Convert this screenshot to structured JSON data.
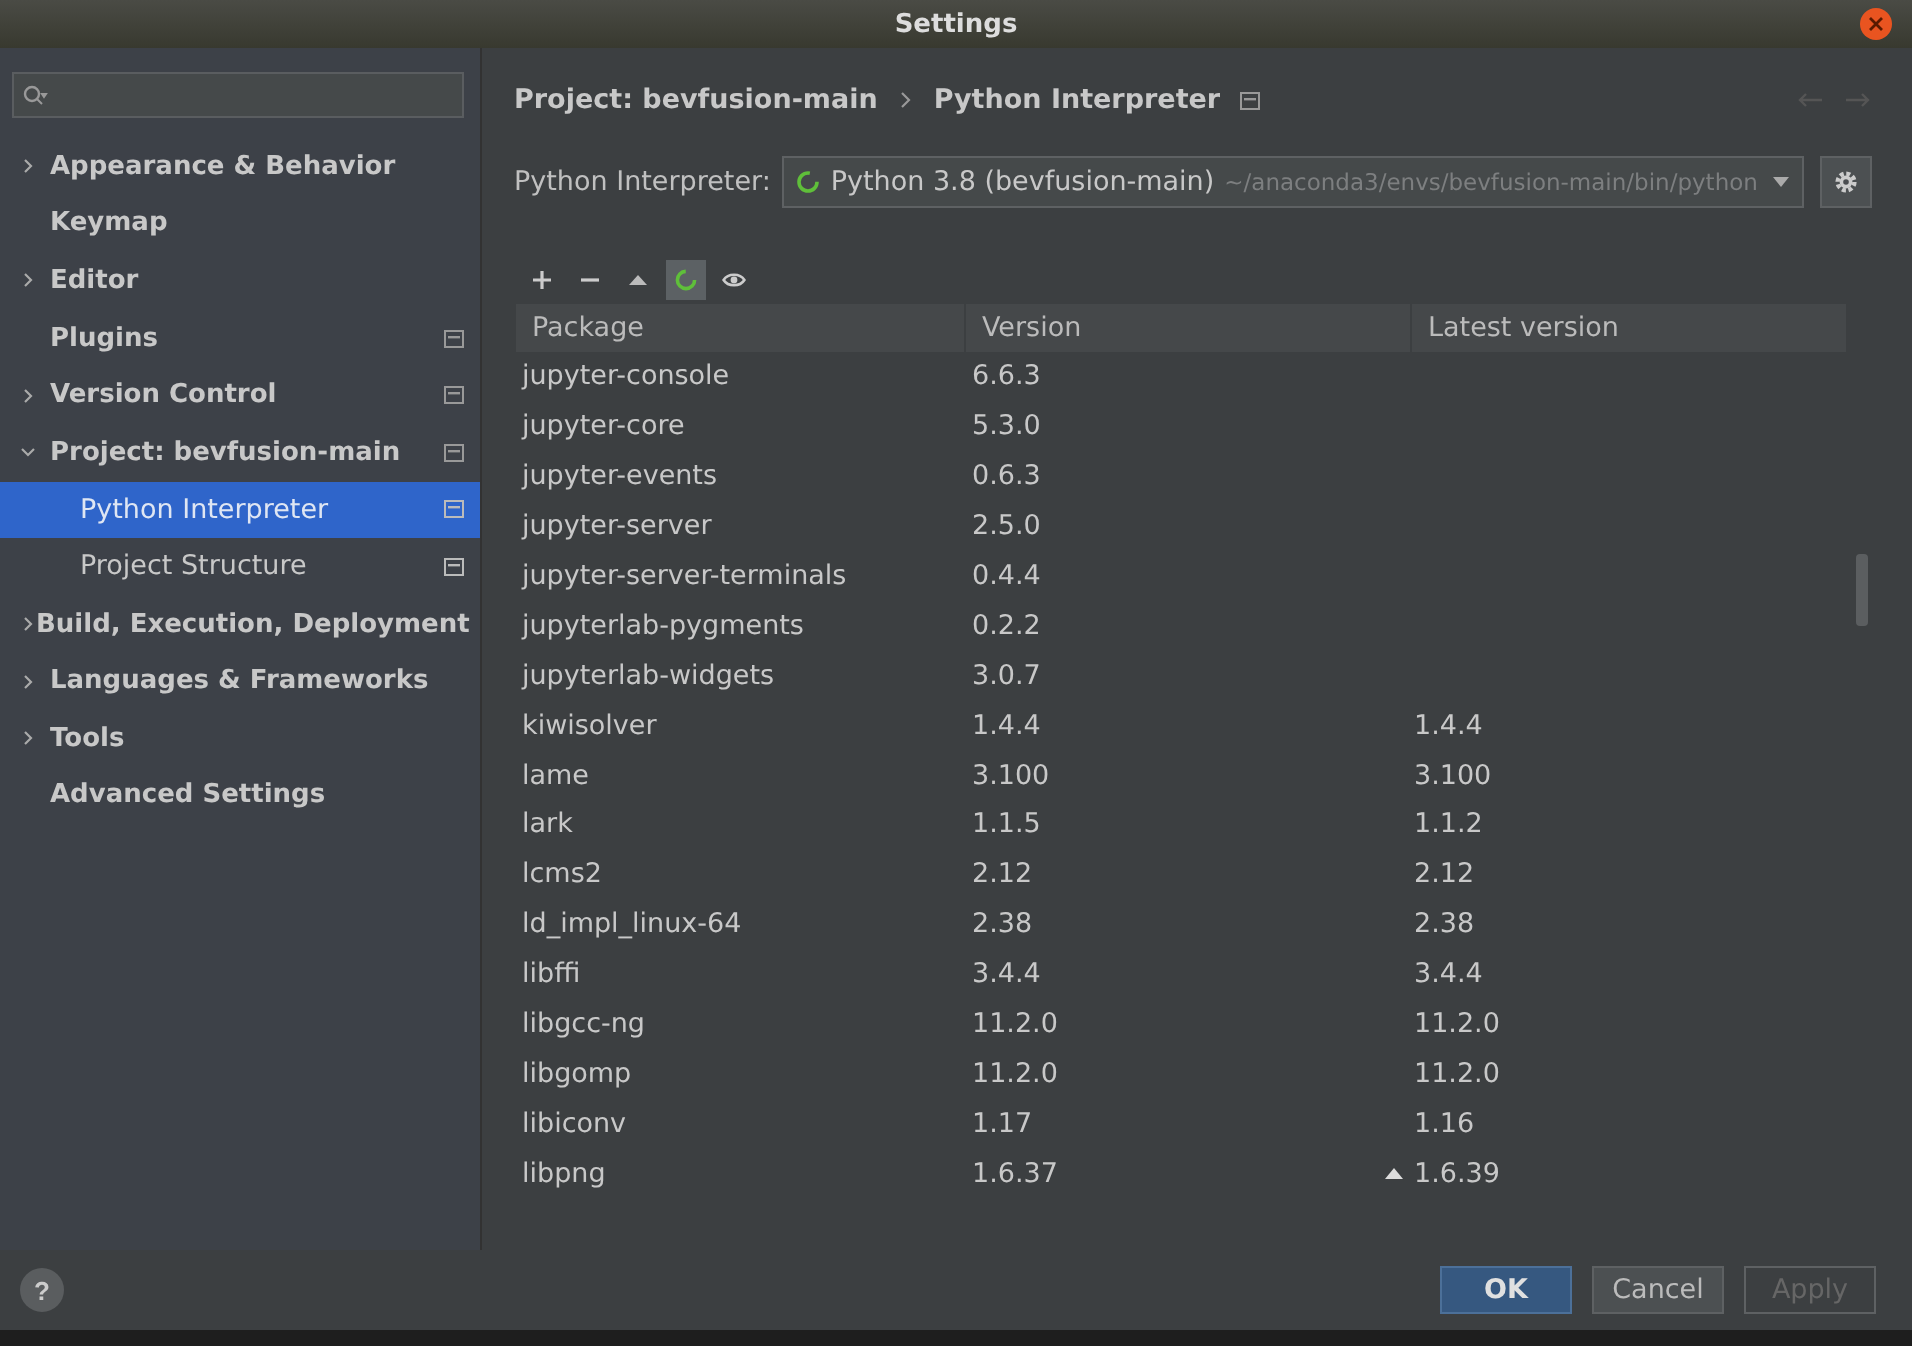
{
  "window": {
    "title": "Settings"
  },
  "help": {
    "label": "?"
  },
  "sidebar": {
    "items": [
      {
        "label": "Appearance & Behavior",
        "expandable": true,
        "expanded": false,
        "project_level": false,
        "selected": false
      },
      {
        "label": "Keymap",
        "expandable": false,
        "project_level": false,
        "selected": false
      },
      {
        "label": "Editor",
        "expandable": true,
        "expanded": false,
        "project_level": false,
        "selected": false
      },
      {
        "label": "Plugins",
        "expandable": false,
        "project_level": true,
        "selected": false
      },
      {
        "label": "Version Control",
        "expandable": true,
        "expanded": false,
        "project_level": true,
        "selected": false
      },
      {
        "label": "Project: bevfusion-main",
        "expandable": true,
        "expanded": true,
        "project_level": true,
        "selected": false,
        "children": [
          {
            "label": "Python Interpreter",
            "project_level": true,
            "selected": true
          },
          {
            "label": "Project Structure",
            "project_level": true,
            "selected": false
          }
        ]
      },
      {
        "label": "Build, Execution, Deployment",
        "expandable": true,
        "expanded": false,
        "project_level": false,
        "selected": false
      },
      {
        "label": "Languages & Frameworks",
        "expandable": true,
        "expanded": false,
        "project_level": false,
        "selected": false
      },
      {
        "label": "Tools",
        "expandable": true,
        "expanded": false,
        "project_level": false,
        "selected": false
      },
      {
        "label": "Advanced Settings",
        "expandable": false,
        "project_level": false,
        "selected": false
      }
    ]
  },
  "breadcrumb": [
    "Project: bevfusion-main",
    "Python Interpreter"
  ],
  "interpreter": {
    "label": "Python Interpreter:",
    "name": "Python 3.8 (bevfusion-main)",
    "path": "~/anaconda3/envs/bevfusion-main/bin/python"
  },
  "toolbar": [
    {
      "kind": "add",
      "pressed": false
    },
    {
      "kind": "remove",
      "pressed": false
    },
    {
      "kind": "upgrade",
      "pressed": false
    },
    {
      "kind": "loading",
      "pressed": true
    },
    {
      "kind": "show",
      "pressed": false
    }
  ],
  "table": {
    "columns": [
      "Package",
      "Version",
      "Latest version"
    ],
    "rows": [
      {
        "package": "jupyter-console",
        "version": "6.6.3",
        "upgrade": false
      },
      {
        "package": "jupyter-core",
        "version": "5.3.0",
        "upgrade": false
      },
      {
        "package": "jupyter-events",
        "version": "0.6.3",
        "upgrade": false
      },
      {
        "package": "jupyter-server",
        "version": "2.5.0",
        "upgrade": false
      },
      {
        "package": "jupyter-server-terminals",
        "version": "0.4.4",
        "upgrade": false
      },
      {
        "package": "jupyterlab-pygments",
        "version": "0.2.2",
        "upgrade": false
      },
      {
        "package": "jupyterlab-widgets",
        "version": "3.0.7",
        "upgrade": false
      },
      {
        "package": "kiwisolver",
        "version": "1.4.4",
        "latest": "1.4.4",
        "upgrade": false
      },
      {
        "package": "lame",
        "version": "3.100",
        "latest": "3.100",
        "upgrade": false
      },
      {
        "package": "lark",
        "version": "1.1.5",
        "latest": "1.1.2",
        "upgrade": false
      },
      {
        "package": "lcms2",
        "version": "2.12",
        "latest": "2.12",
        "upgrade": false
      },
      {
        "package": "ld_impl_linux-64",
        "version": "2.38",
        "latest": "2.38",
        "upgrade": false
      },
      {
        "package": "libffi",
        "version": "3.4.4",
        "latest": "3.4.4",
        "upgrade": false
      },
      {
        "package": "libgcc-ng",
        "version": "11.2.0",
        "latest": "11.2.0",
        "upgrade": false
      },
      {
        "package": "libgomp",
        "version": "11.2.0",
        "latest": "11.2.0",
        "upgrade": false
      },
      {
        "package": "libiconv",
        "version": "1.17",
        "latest": "1.16",
        "upgrade": false
      },
      {
        "package": "libpng",
        "version": "1.6.37",
        "latest": "1.6.39",
        "upgrade": true
      }
    ]
  },
  "buttons": [
    {
      "label": "OK",
      "kind": "primary",
      "disabled": false
    },
    {
      "label": "Cancel",
      "kind": "normal",
      "disabled": false
    },
    {
      "label": "Apply",
      "kind": "normal",
      "disabled": true
    }
  ]
}
